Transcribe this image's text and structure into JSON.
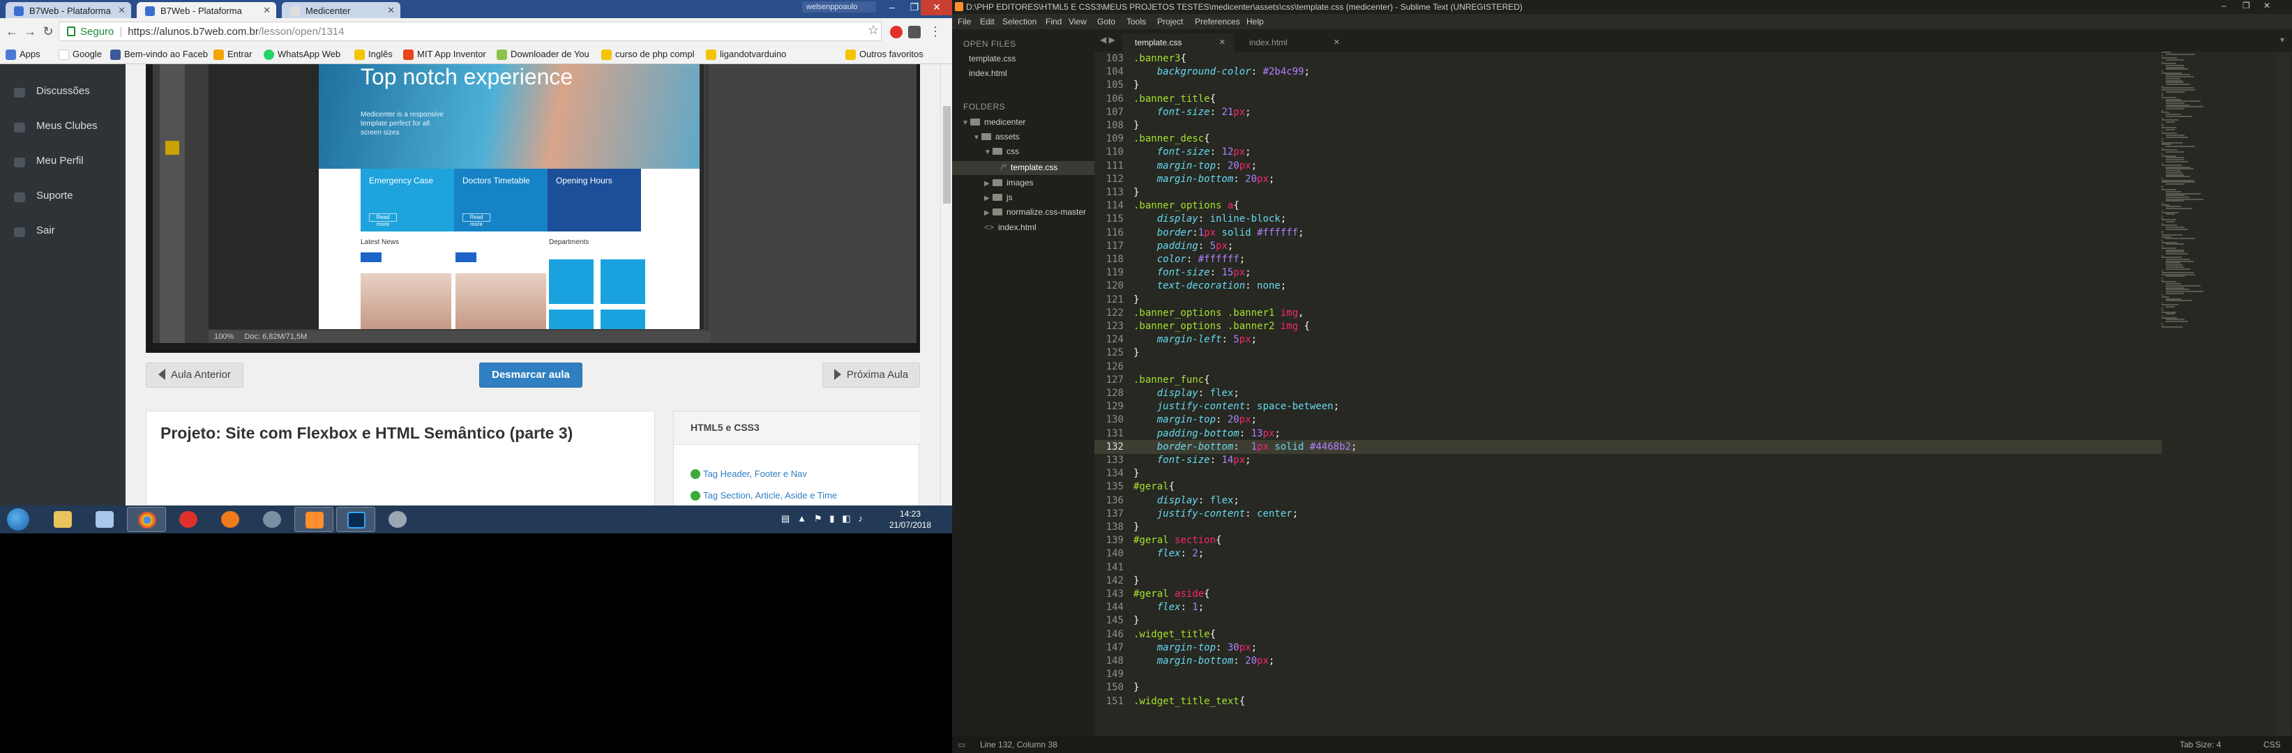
{
  "browser": {
    "tabs": [
      {
        "label": "B7Web - Plataforma",
        "active": false
      },
      {
        "label": "B7Web - Plataforma",
        "active": true
      },
      {
        "label": "Medicenter",
        "active": false
      }
    ],
    "user_chip": "welsenppoaulo",
    "url": {
      "secure_label": "Seguro",
      "host": "https://alunos.b7web.com.br",
      "path": "/lesson/open/1314"
    },
    "bookmarks": [
      {
        "label": "Apps",
        "color": "#4a79d6"
      },
      {
        "label": "Google",
        "color": "#ffffff"
      },
      {
        "label": "Bem-vindo ao Faceb",
        "color": "#3b5998"
      },
      {
        "label": "Entrar",
        "color": "#f4a300"
      },
      {
        "label": "WhatsApp Web",
        "color": "#25d366"
      },
      {
        "label": "Inglês",
        "color": "#f2c500"
      },
      {
        "label": "MIT App Inventor",
        "color": "#e8441b"
      },
      {
        "label": "Downloader de You",
        "color": "#8bc34a"
      },
      {
        "label": "curso de php compl",
        "color": "#f2c500"
      },
      {
        "label": "ligandotvarduino",
        "color": "#f2c500"
      },
      {
        "label": "Outros favoritos",
        "color": "#f2c500"
      }
    ],
    "sidebar": [
      {
        "label": "Discussões"
      },
      {
        "label": "Meus Clubes"
      },
      {
        "label": "Meu Perfil"
      },
      {
        "label": "Suporte"
      },
      {
        "label": "Sair"
      }
    ],
    "video": {
      "hero_title": "Top notch experience",
      "hero_desc": "Medicenter is a responsive template perfect for all screen sizes",
      "features": [
        "Emergency Case",
        "Doctors Timetable",
        "Opening Hours"
      ],
      "feature_button": "Read more",
      "latest_news": "Latest News",
      "departments": "Departments",
      "ps_zoom": "100%",
      "ps_doc": "Doc: 6,82M/71,5M"
    },
    "controls": {
      "prev": "Aula Anterior",
      "toggle": "Desmarcar aula",
      "next": "Próxima Aula"
    },
    "lesson": {
      "title": "Projeto: Site com Flexbox e HTML Semântico (parte 3)"
    },
    "module": {
      "title": "HTML5 e CSS3",
      "items": [
        {
          "label": "Tag Header, Footer e Nav"
        },
        {
          "label": "Tag Section, Article, Aside e Time"
        }
      ]
    }
  },
  "taskbar": {
    "time": "14:23",
    "date": "21/07/2018"
  },
  "sublime": {
    "title": "D:\\PHP EDITORES\\HTML5 E CSS3\\MEUS PROJETOS TESTES\\medicenter\\assets\\css\\template.css (medicenter) - Sublime Text (UNREGISTERED)",
    "menu": [
      "File",
      "Edit",
      "Selection",
      "Find",
      "View",
      "Goto",
      "Tools",
      "Project",
      "Preferences",
      "Help"
    ],
    "open_files_label": "OPEN FILES",
    "open_files": [
      "template.css",
      "index.html"
    ],
    "folders_label": "FOLDERS",
    "tree": [
      {
        "label": "medicenter",
        "depth": 0,
        "kind": "folder",
        "open": true
      },
      {
        "label": "assets",
        "depth": 1,
        "kind": "folder",
        "open": true
      },
      {
        "label": "css",
        "depth": 2,
        "kind": "folder",
        "open": true
      },
      {
        "label": "template.css",
        "depth": 3,
        "kind": "file",
        "selected": true
      },
      {
        "label": "images",
        "depth": 2,
        "kind": "folder",
        "open": false
      },
      {
        "label": "js",
        "depth": 2,
        "kind": "folder",
        "open": false
      },
      {
        "label": "normalize.css-master",
        "depth": 2,
        "kind": "folder",
        "open": false
      },
      {
        "label": "index.html",
        "depth": 1,
        "kind": "file",
        "selected": false
      }
    ],
    "tabs": [
      {
        "label": "template.css",
        "active": true
      },
      {
        "label": "index.html",
        "active": false
      }
    ],
    "status_left": "Line 132, Column 38",
    "status_tab": "Tab Size: 4",
    "status_syntax": "CSS",
    "current_line": 132,
    "code": [
      {
        "n": "103",
        "t": ".banner3{"
      },
      {
        "n": "104",
        "t": "    background-color: #2b4c99;"
      },
      {
        "n": "105",
        "t": "}"
      },
      {
        "n": "106",
        "t": ".banner_title{"
      },
      {
        "n": "107",
        "t": "    font-size: 21px;"
      },
      {
        "n": "108",
        "t": "}"
      },
      {
        "n": "109",
        "t": ".banner_desc{"
      },
      {
        "n": "110",
        "t": "    font-size: 12px;"
      },
      {
        "n": "111",
        "t": "    margin-top: 20px;"
      },
      {
        "n": "112",
        "t": "    margin-bottom: 20px;"
      },
      {
        "n": "113",
        "t": "}"
      },
      {
        "n": "114",
        "t": ".banner_options a{"
      },
      {
        "n": "115",
        "t": "    display: inline-block;"
      },
      {
        "n": "116",
        "t": "    border:1px solid #ffffff;"
      },
      {
        "n": "117",
        "t": "    padding: 5px;"
      },
      {
        "n": "118",
        "t": "    color: #ffffff;"
      },
      {
        "n": "119",
        "t": "    font-size: 15px;"
      },
      {
        "n": "120",
        "t": "    text-decoration: none;"
      },
      {
        "n": "121",
        "t": "}"
      },
      {
        "n": "122",
        "t": ".banner_options .banner1 img,"
      },
      {
        "n": "123",
        "t": ".banner_options .banner2 img {"
      },
      {
        "n": "124",
        "t": "    margin-left: 5px;"
      },
      {
        "n": "125",
        "t": "}"
      },
      {
        "n": "126",
        "t": ""
      },
      {
        "n": "127",
        "t": ".banner_func{"
      },
      {
        "n": "128",
        "t": "    display: flex;"
      },
      {
        "n": "129",
        "t": "    justify-content: space-between;"
      },
      {
        "n": "130",
        "t": "    margin-top: 20px;"
      },
      {
        "n": "131",
        "t": "    padding-bottom: 13px;"
      },
      {
        "n": "132",
        "t": "    border-bottom:  1px solid #4468b2;"
      },
      {
        "n": "133",
        "t": "    font-size: 14px;"
      },
      {
        "n": "134",
        "t": "}"
      },
      {
        "n": "135",
        "t": "#geral{"
      },
      {
        "n": "136",
        "t": "    display: flex;"
      },
      {
        "n": "137",
        "t": "    justify-content: center;"
      },
      {
        "n": "138",
        "t": "}"
      },
      {
        "n": "139",
        "t": "#geral section{"
      },
      {
        "n": "140",
        "t": "    flex: 2;"
      },
      {
        "n": "141",
        "t": ""
      },
      {
        "n": "142",
        "t": "}"
      },
      {
        "n": "143",
        "t": "#geral aside{"
      },
      {
        "n": "144",
        "t": "    flex: 1;"
      },
      {
        "n": "145",
        "t": "}"
      },
      {
        "n": "146",
        "t": ".widget_title{"
      },
      {
        "n": "147",
        "t": "    margin-top: 30px;"
      },
      {
        "n": "148",
        "t": "    margin-bottom: 20px;"
      },
      {
        "n": "149",
        "t": ""
      },
      {
        "n": "150",
        "t": "}"
      },
      {
        "n": "151",
        "t": ".widget_title_text{"
      }
    ]
  }
}
